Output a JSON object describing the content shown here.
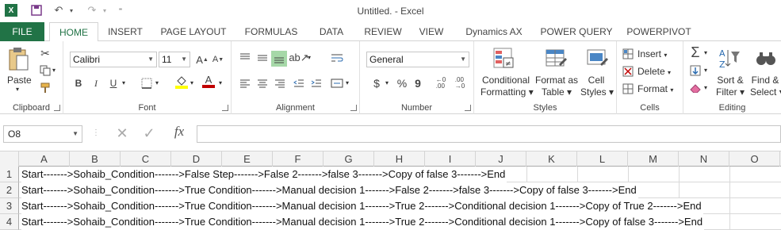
{
  "window": {
    "title": "Untitled. - Excel"
  },
  "colors": {
    "brand": "#217346",
    "fill_yellow": "#ffff00",
    "font_red": "#c00000"
  },
  "tabs": [
    {
      "label": "FILE"
    },
    {
      "label": "HOME"
    },
    {
      "label": "INSERT"
    },
    {
      "label": "PAGE LAYOUT"
    },
    {
      "label": "FORMULAS"
    },
    {
      "label": "DATA"
    },
    {
      "label": "REVIEW"
    },
    {
      "label": "VIEW"
    },
    {
      "label": "Dynamics AX"
    },
    {
      "label": "POWER QUERY"
    },
    {
      "label": "POWERPIVOT"
    }
  ],
  "ribbon": {
    "clipboard": {
      "paste": "Paste",
      "label": "Clipboard"
    },
    "font": {
      "name": "Calibri",
      "size": "11",
      "bold": "B",
      "italic": "I",
      "underline": "U",
      "grow": "A",
      "shrink": "A",
      "font_color": "A",
      "label": "Font"
    },
    "alignment": {
      "label": "Alignment"
    },
    "number": {
      "format": "General",
      "currency": "$",
      "percent": "%",
      "comma": "9",
      "label": "Number"
    },
    "styles": {
      "conditional": [
        "Conditional",
        "Formatting"
      ],
      "format_table": [
        "Format as",
        "Table"
      ],
      "cell_styles": [
        "Cell",
        "Styles"
      ],
      "label": "Styles"
    },
    "cells": {
      "insert": "Insert",
      "delete": "Delete",
      "format": "Format",
      "label": "Cells"
    },
    "editing": {
      "sort": [
        "Sort &",
        "Filter"
      ],
      "find": [
        "Find &",
        "Select"
      ],
      "label": "Editing"
    }
  },
  "formula_bar": {
    "name_box": "O8",
    "fx": "fx",
    "value": ""
  },
  "sheet": {
    "columns": [
      "A",
      "B",
      "C",
      "D",
      "E",
      "F",
      "G",
      "H",
      "I",
      "J",
      "K",
      "L",
      "M",
      "N",
      "O"
    ],
    "rows": [
      {
        "num": "1",
        "text": "Start------->Sohaib_Condition------->False Step------->False 2------->false 3------->Copy of false 3------->End"
      },
      {
        "num": "2",
        "text": "Start------->Sohaib_Condition------->True Condition------->Manual decision 1------->False 2------->false 3------->Copy of false 3------->End"
      },
      {
        "num": "3",
        "text": "Start------->Sohaib_Condition------->True Condition------->Manual decision 1------->True 2------->Conditional decision 1------->Copy of True 2------->End"
      },
      {
        "num": "4",
        "text": "Start------->Sohaib_Condition------->True Condition------->Manual decision 1------->True 2------->Conditional decision 1------->Copy of false 3------->End"
      }
    ]
  }
}
